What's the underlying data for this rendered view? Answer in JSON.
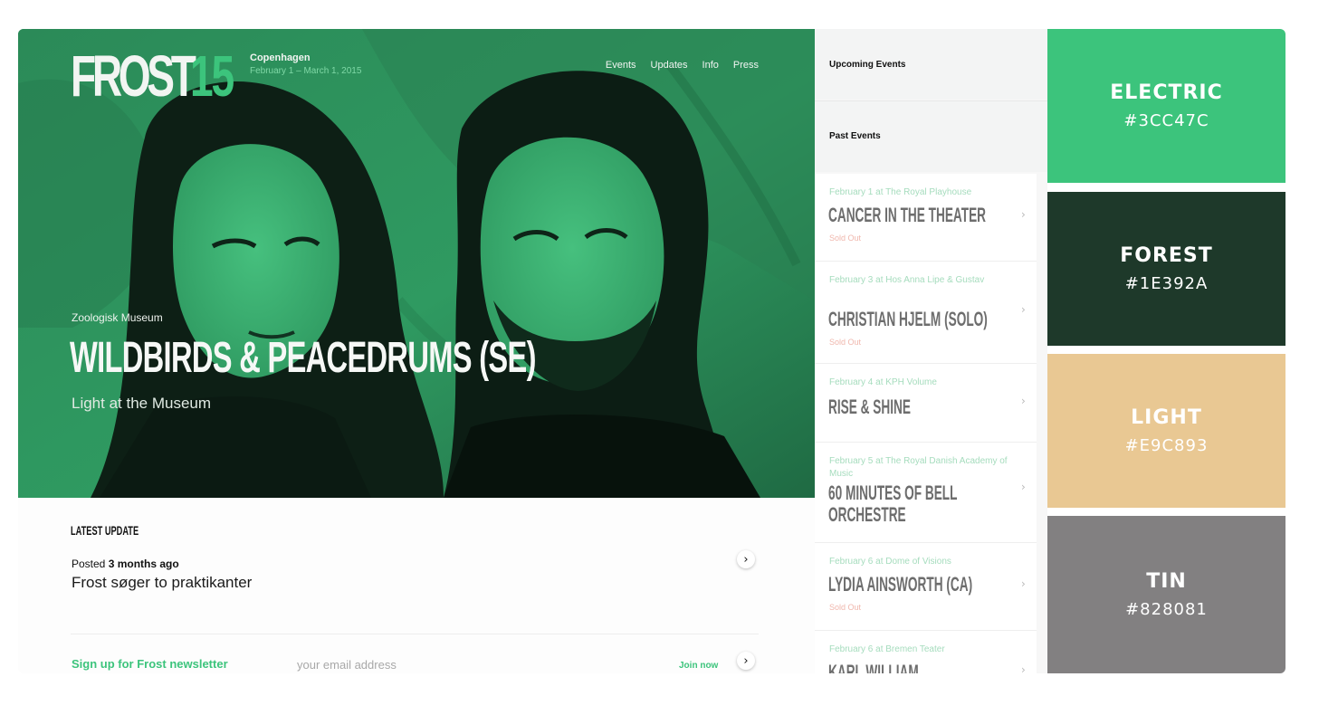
{
  "brand": {
    "name": "FROST",
    "number": "15",
    "city": "Copenhagen",
    "dates": "February 1 – March 1, 2015"
  },
  "nav": [
    "Events",
    "Updates",
    "Info",
    "Press"
  ],
  "hero": {
    "venue": "Zoologisk Museum",
    "headline": "WILDBIRDS & PEACEDRUMS (SE)",
    "subtitle": "Light at the Museum"
  },
  "latest": {
    "heading": "LATEST UPDATE",
    "posted_prefix": "Posted",
    "posted_time": "3 months ago",
    "title": "Frost søger to praktikanter",
    "arrow": "›"
  },
  "newsletter": {
    "label": "Sign up for Frost newsletter",
    "placeholder": "your email address",
    "join": "Join now",
    "arrow": "›"
  },
  "sidebar": {
    "tabs": [
      "Upcoming Events",
      "Past Events"
    ],
    "events": [
      {
        "meta": "February 1 at The Royal Playhouse",
        "title": "CANCER IN THE THEATER",
        "status": "Sold Out"
      },
      {
        "meta": "February 3 at Hos Anna Lipe & Gustav",
        "title": "CHRISTIAN HJELM (SOLO)",
        "status": "Sold Out"
      },
      {
        "meta": "February 4 at KPH Volume",
        "title": "RISE & SHINE",
        "status": ""
      },
      {
        "meta": "February 5 at The Royal Danish Academy of Music",
        "title": "60 MINUTES OF BELL ORCHESTRE",
        "title2": "ORCHESTRE",
        "status": ""
      },
      {
        "meta": "February 6 at Dome of Visions",
        "title": "LYDIA AINSWORTH (CA)",
        "status": "Sold Out"
      },
      {
        "meta": "February 6 at Bremen Teater",
        "title": "KARL WILLIAM",
        "status": ""
      }
    ],
    "chevron": "›"
  },
  "palette": [
    {
      "name": "ELECTRIC",
      "hex": "#3CC47C",
      "color": "#3cc47c",
      "text": "#ffffff"
    },
    {
      "name": "FOREST",
      "hex": "#1E392A",
      "color": "#1e392a",
      "text": "#ffffff"
    },
    {
      "name": "LIGHT",
      "hex": "#E9C893",
      "color": "#e9c893",
      "text": "#ffffff"
    },
    {
      "name": "TIN",
      "hex": "#828081",
      "color": "#828081",
      "text": "#ffffff"
    }
  ]
}
